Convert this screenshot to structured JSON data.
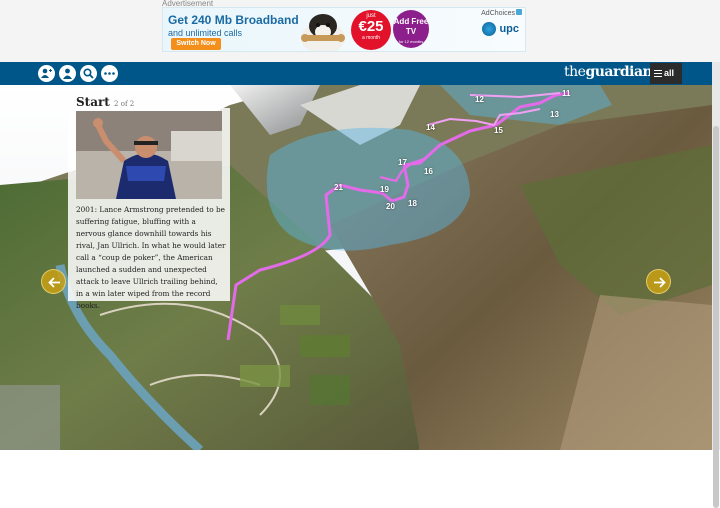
{
  "ad": {
    "label": "Advertisement",
    "headline": "Get 240 Mb Broadband",
    "subline": "and unlimited calls",
    "cta": "Switch Now",
    "price_top": "just",
    "price": "€25",
    "price_bottom": "a month",
    "free_tv": "Add Free TV",
    "free_tv_small": "for 12 months",
    "adchoices": "AdChoices",
    "brand": "upc"
  },
  "navbar": {
    "icons": [
      "add-user-icon",
      "user-icon",
      "search-icon",
      "more-icon"
    ],
    "brand_prefix": "the",
    "brand_name": "guardian",
    "all_label": "all",
    "bg": "#005689"
  },
  "card": {
    "title": "Start",
    "page": "2 of 2",
    "text": "2001: Lance Armstrong pretended to be suffering fatigue, bluffing with a nervous glance downhill towards his rival, Jan Ullrich. In what he would later call a “coup de poker”, the American launched a sudden and unexpected attack to leave Ullrich trailing behind, in a win later wiped from the record books."
  },
  "markers": [
    "11",
    "12",
    "13",
    "14",
    "15",
    "16",
    "17",
    "18",
    "19",
    "20",
    "21"
  ],
  "route_color": "#e36bea",
  "nav_color": "#c9a218"
}
